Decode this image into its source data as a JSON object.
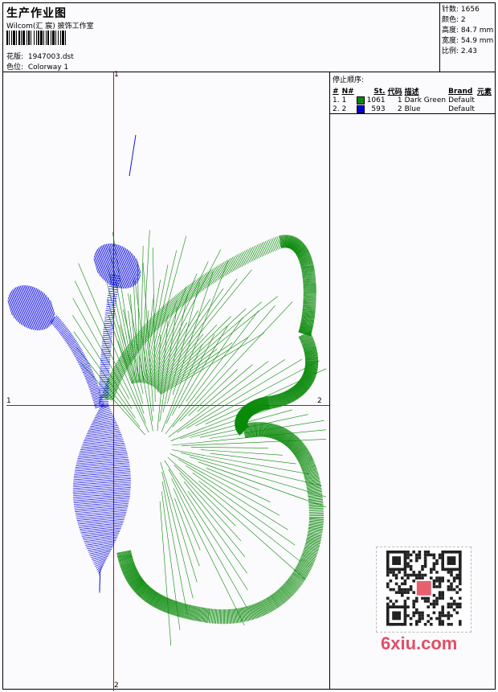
{
  "header": {
    "title": "生产作业图",
    "subtitle": "Wilcom(汇 宸) 披饰工作室",
    "design_label": "花版:",
    "design_value": "1947003.dst",
    "colorway_label": "色位:",
    "colorway_value": "Colorway 1"
  },
  "info": {
    "stitches": "针数: 1656",
    "colors": "颜色: 2",
    "height": "高度: 84.7 mm",
    "width": "宽度: 54.9 mm",
    "scale": "比例: 2.43"
  },
  "legend": {
    "caption": "停止顺序:",
    "headers": [
      "#",
      "N#",
      "St.",
      "代码",
      "描述",
      "Brand",
      "元素"
    ],
    "rows": [
      {
        "no": "1.",
        "n": "1",
        "color": "#0a8a0a",
        "st": "1061",
        "code": "1",
        "desc": "Dark Green",
        "brand": "Default"
      },
      {
        "no": "2.",
        "n": "2",
        "color": "#0000e0",
        "st": "593",
        "code": "2",
        "desc": "Blue",
        "brand": "Default"
      }
    ]
  },
  "axes": {
    "v_top": "1",
    "v_bottom": "2",
    "h_left": "1",
    "h_right": "2"
  },
  "watermark": {
    "text": "6xiu.com"
  },
  "colors": {
    "thread_green": "#0a8a0a",
    "thread_blue": "#0000e0",
    "axis": "#e00000"
  }
}
